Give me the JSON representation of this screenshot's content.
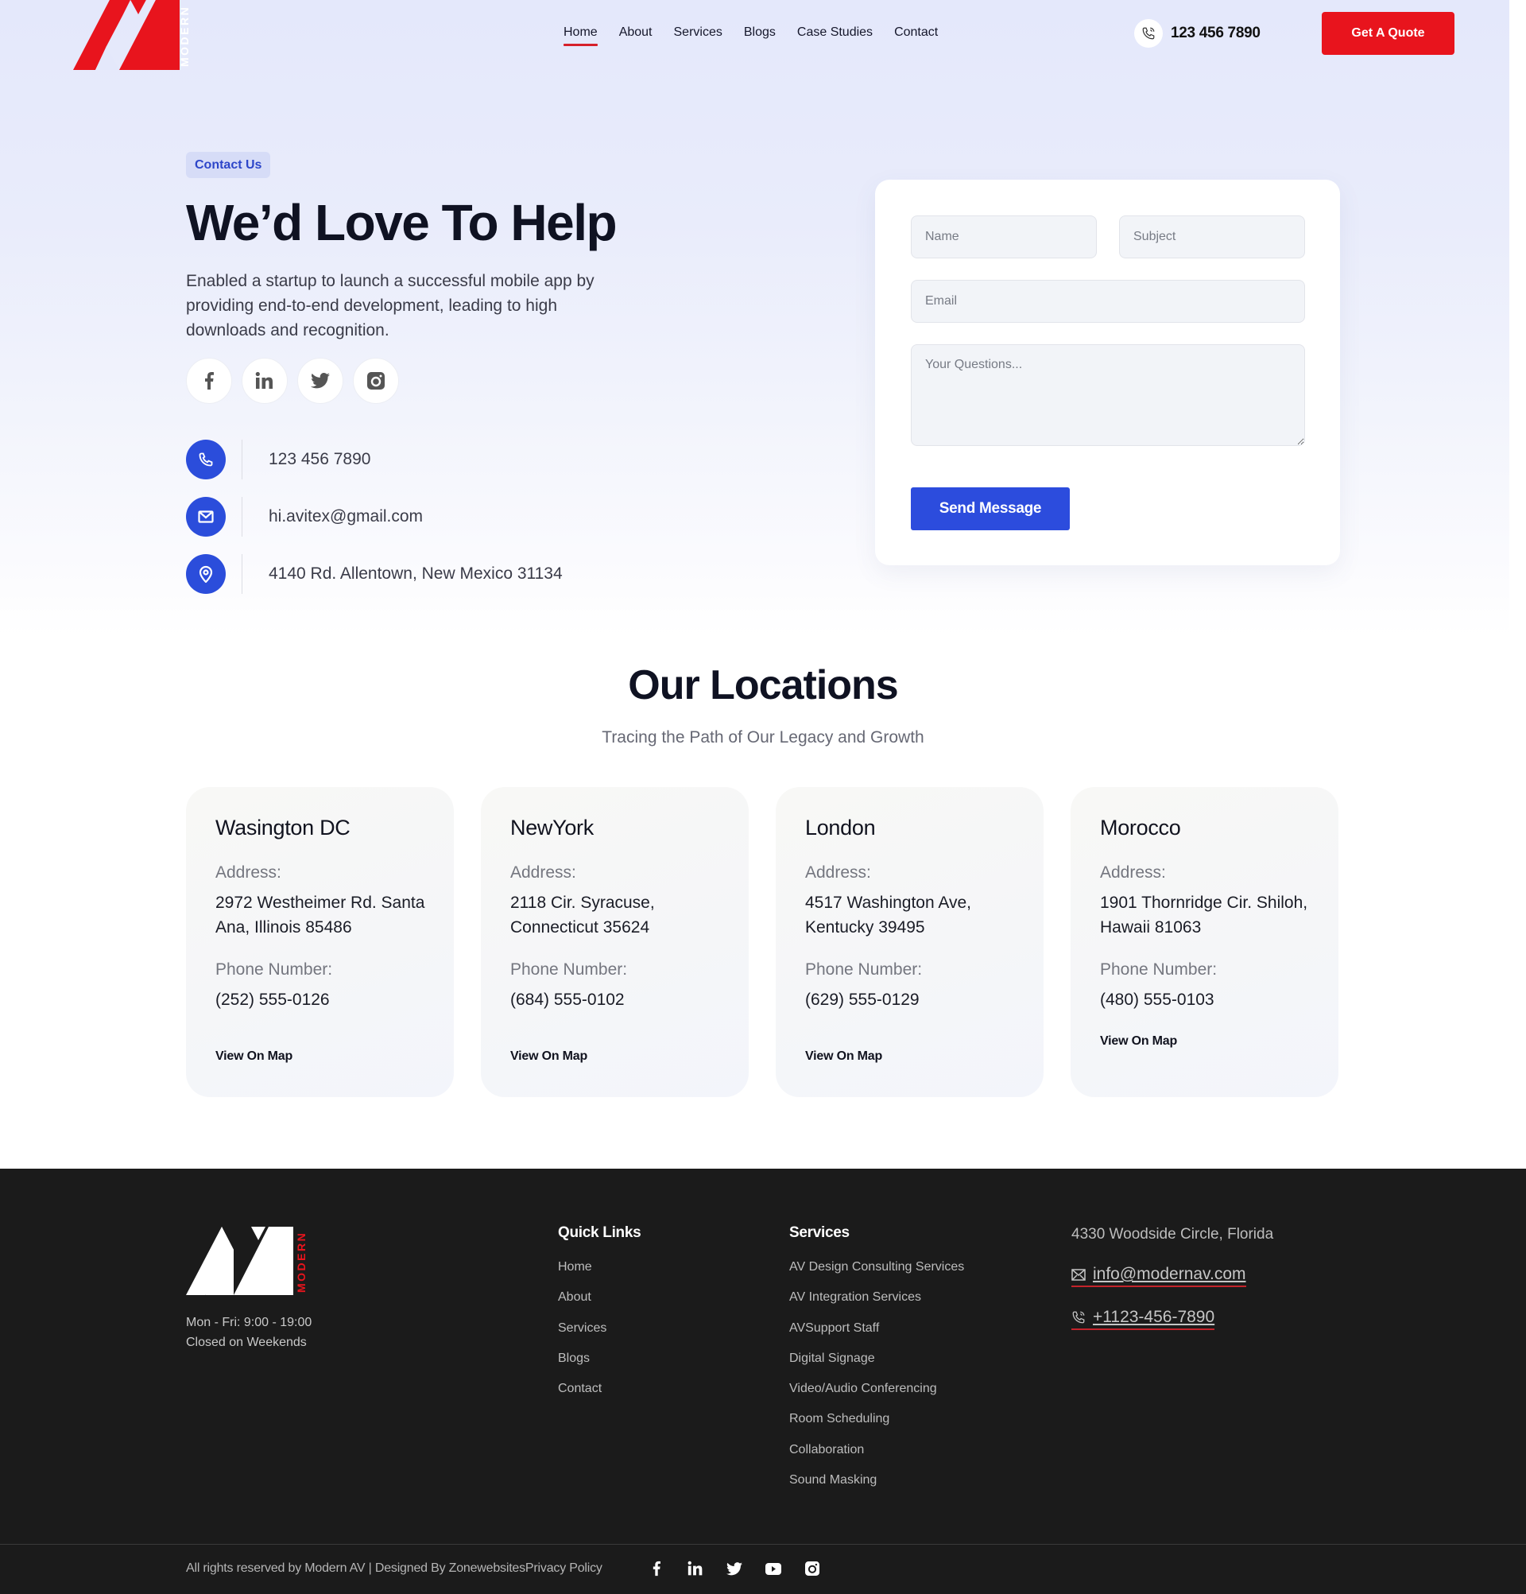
{
  "brand": {
    "logo_text": "MODERN",
    "logo_alt": "Modern AV",
    "accent_red": "#e8141d",
    "accent_blue": "#2c4cdd"
  },
  "nav": {
    "items": [
      {
        "label": "Home",
        "active": true
      },
      {
        "label": "About",
        "active": false
      },
      {
        "label": "Services",
        "active": false
      },
      {
        "label": "Blogs",
        "active": false
      },
      {
        "label": "Case Studies",
        "active": false
      },
      {
        "label": "Contact",
        "active": false
      }
    ],
    "phone": "123 456 7890",
    "quote_button": "Get A Quote"
  },
  "hero": {
    "badge": "Contact Us",
    "title": "We’d Love To Help",
    "description": "Enabled a startup to launch a successful mobile app by providing end-to-end development, leading to high downloads and recognition.",
    "socials": [
      "facebook-icon",
      "linkedin-icon",
      "twitter-icon",
      "instagram-icon"
    ],
    "contacts": [
      {
        "icon": "phone-icon",
        "value": "123 456 7890"
      },
      {
        "icon": "mail-icon",
        "value": "hi.avitex@gmail.com"
      },
      {
        "icon": "location-pin-icon",
        "value": "4140 Rd. Allentown, New Mexico 31134"
      }
    ]
  },
  "form": {
    "name_placeholder": "Name",
    "subject_placeholder": "Subject",
    "email_placeholder": "Email",
    "message_placeholder": "Your Questions...",
    "submit_label": "Send Message"
  },
  "locations": {
    "title": "Our Locations",
    "subtitle": "Tracing the Path of Our Legacy and Growth",
    "address_label": "Address:",
    "phone_label": "Phone Number:",
    "link_label": "View On Map",
    "cards": [
      {
        "name": "Wasington DC",
        "address": "2972 Westheimer Rd. Santa Ana, Illinois 85486",
        "phone": "(252) 555-0126"
      },
      {
        "name": "NewYork",
        "address": "2118 Cir. Syracuse, Connecticut 35624",
        "phone": "(684) 555-0102"
      },
      {
        "name": "London",
        "address": "4517 Washington Ave, Kentucky 39495",
        "phone": "(629) 555-0129"
      },
      {
        "name": "Morocco",
        "address": "1901 Thornridge Cir. Shiloh, Hawaii 81063",
        "phone": "(480) 555-0103"
      }
    ]
  },
  "footer": {
    "hours_line1": "Mon - Fri: 9:00 - 19:00",
    "hours_line2": "Closed on Weekends",
    "quick_links_title": "Quick Links",
    "quick_links": [
      "Home",
      "About",
      "Services",
      "Blogs",
      "Contact"
    ],
    "services_title": "Services",
    "services": [
      "AV Design Consulting Services",
      "AV Integration Services",
      "AVSupport Staff",
      "Digital Signage",
      "Video/Audio Conferencing",
      "Room Scheduling",
      "Collaboration",
      "Sound Masking"
    ],
    "address": "4330 Woodside Circle, Florida",
    "email": "info@modernav.com",
    "phone": "+1123-456-7890",
    "copyright": "All rights reserved by Modern AV | Designed By ZonewebsitesPrivacy Policy",
    "socials": [
      "facebook-icon",
      "linkedin-icon",
      "twitter-icon",
      "youtube-icon",
      "instagram-icon"
    ]
  }
}
